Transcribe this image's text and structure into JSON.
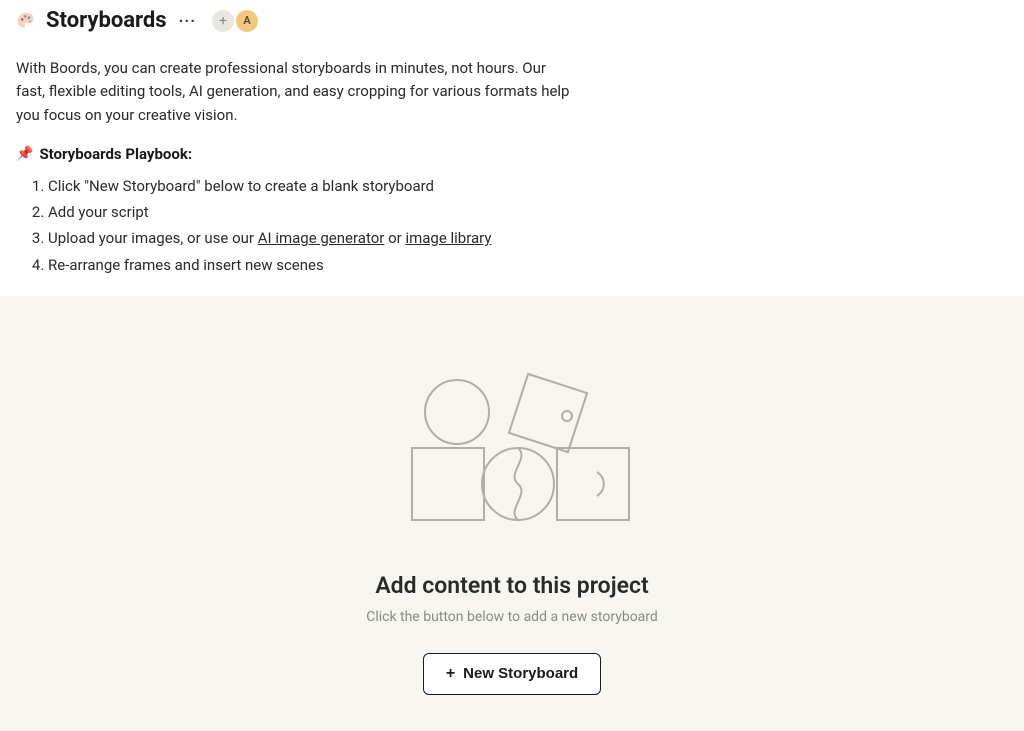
{
  "header": {
    "title": "Storyboards",
    "avatar_initial": "A",
    "description": "With Boords, you can create professional storyboards in minutes, not hours. Our fast, flexible editing tools, AI generation, and easy cropping for various formats help you focus on your creative vision."
  },
  "playbook": {
    "title": "Storyboards Playbook:",
    "steps": [
      "Click \"New Storyboard\" below to create a blank storyboard",
      "Add your script",
      "Upload your images, or use our ",
      "Re-arrange frames and insert new scenes"
    ],
    "step3_link1": "AI image generator",
    "step3_mid": " or ",
    "step3_link2": "image library"
  },
  "empty": {
    "title": "Add content to this project",
    "subtitle": "Click the button below to add a new storyboard",
    "button_label": "New Storyboard"
  }
}
